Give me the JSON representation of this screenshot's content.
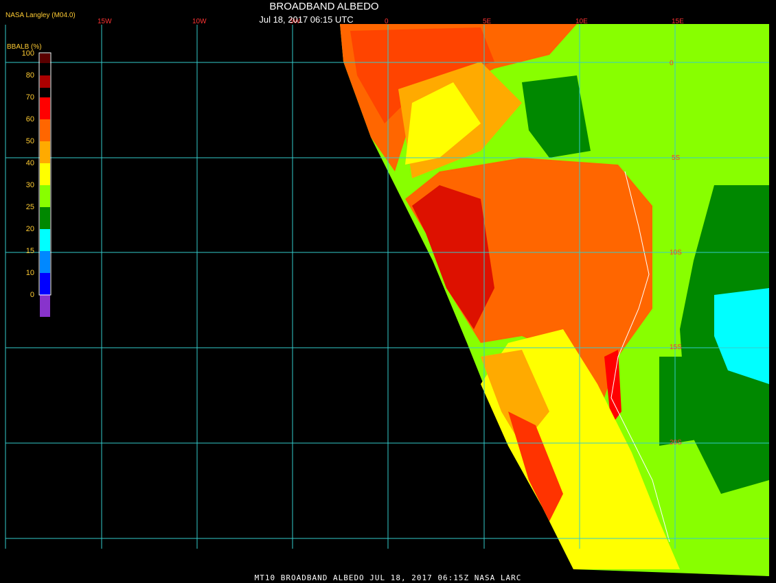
{
  "header": {
    "title": "BROADBAND ALBEDO",
    "datetime": "Jul 18, 2017 06:15 UTC",
    "credit": "NASA Langley (M04.0)"
  },
  "footer": {
    "text": "MT10  BROADBAND ALBEDO   JUL 18, 2017 06:15Z   NASA LARC"
  },
  "legend": {
    "title": "BBALB (%)",
    "ticks": [
      "100",
      "80",
      "70",
      "60",
      "50",
      "40",
      "30",
      "25",
      "20",
      "15",
      "10",
      "0"
    ],
    "colors": [
      "#5a0000",
      "#aa0000",
      "#ff0000",
      "#ff6600",
      "#ffaa00",
      "#ffff00",
      "#88ff00",
      "#008800",
      "#00ffff",
      "#0088ff",
      "#0000ff",
      "#8833cc"
    ]
  },
  "grid": {
    "lon_labels": [
      "15W",
      "10W",
      "5W",
      "0",
      "5E",
      "10E",
      "15E"
    ],
    "lat_labels": [
      "0",
      "5S",
      "10S",
      "15S",
      "20S"
    ],
    "line_color": "#33cccc",
    "label_color": "#ff3333"
  }
}
